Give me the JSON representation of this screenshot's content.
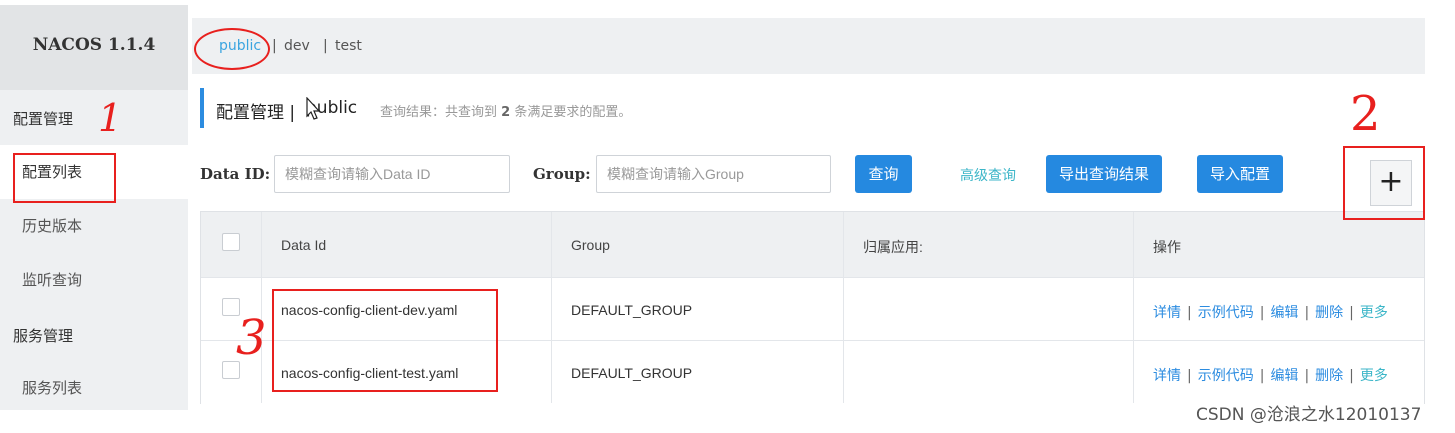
{
  "app": {
    "title": "NACOS 1.1.4"
  },
  "sidebar": {
    "config_section": "配置管理",
    "config_items": [
      {
        "label": "配置列表",
        "active": true
      },
      {
        "label": "历史版本",
        "active": false
      },
      {
        "label": "监听查询",
        "active": false
      }
    ],
    "service_section": "服务管理",
    "service_items": [
      {
        "label": "服务列表",
        "active": false
      }
    ]
  },
  "namespaces": {
    "tabs": [
      "public",
      "dev",
      "test"
    ],
    "active": "public",
    "separator": "|"
  },
  "page": {
    "title": "配置管理",
    "separator": "|",
    "namespace": "public",
    "query_prefix": "查询结果：共查询到",
    "query_count": "2",
    "query_suffix": "条满足要求的配置。"
  },
  "search": {
    "data_id_label": "Data ID:",
    "data_id_placeholder": "模糊查询请输入Data ID",
    "group_label": "Group:",
    "group_placeholder": "模糊查询请输入Group",
    "query_button": "查询",
    "advanced_link": "高级查询",
    "export_button": "导出查询结果",
    "import_button": "导入配置",
    "add_button": "+"
  },
  "table": {
    "columns": [
      "Data Id",
      "Group",
      "归属应用:",
      "操作"
    ],
    "rows": [
      {
        "data_id": "nacos-config-client-dev.yaml",
        "group": "DEFAULT_GROUP",
        "app": ""
      },
      {
        "data_id": "nacos-config-client-test.yaml",
        "group": "DEFAULT_GROUP",
        "app": ""
      }
    ],
    "actions": [
      "详情",
      "示例代码",
      "编辑",
      "删除",
      "更多"
    ],
    "action_separator": "|"
  },
  "annotations": {
    "mark_1": "1",
    "mark_2": "2",
    "mark_3": "3"
  },
  "watermark": "CSDN @沧浪之水12010137",
  "colors": {
    "primary": "#2589e0",
    "link": "#3cb6c8",
    "annotation_red": "#e8201e",
    "sidebar_bg": "#eef0f2"
  }
}
